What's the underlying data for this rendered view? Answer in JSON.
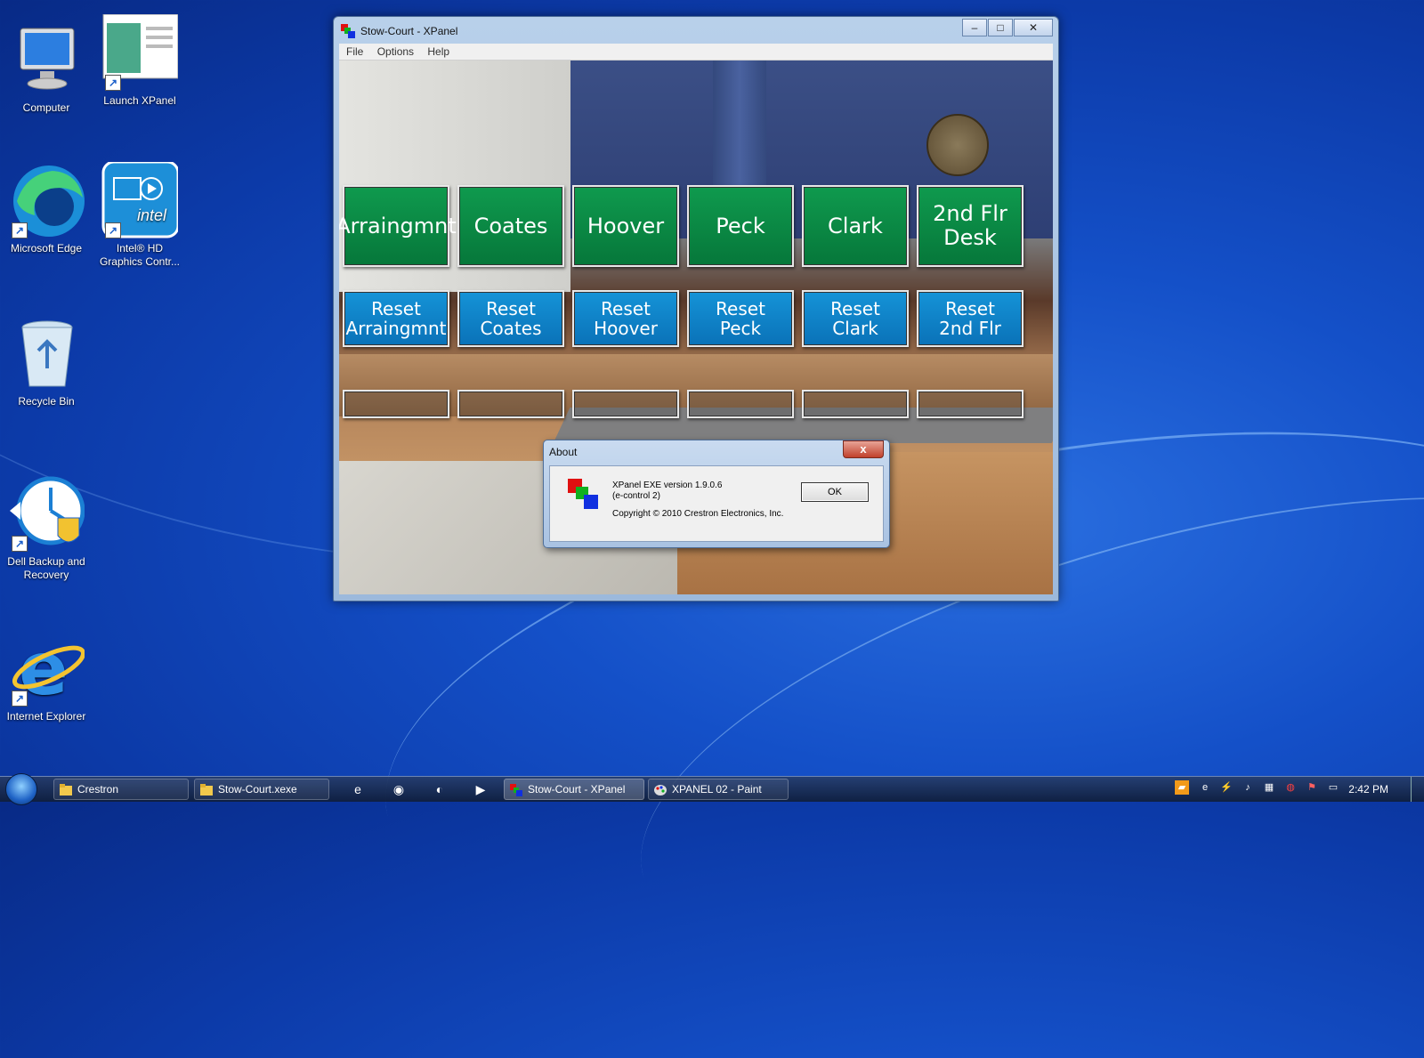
{
  "desktop": {
    "icons": [
      {
        "label": "Computer",
        "icon": "computer-icon"
      },
      {
        "label": "Launch XPanel",
        "icon": "xpanel-launch-icon"
      },
      {
        "label": "Microsoft Edge",
        "icon": "edge-icon"
      },
      {
        "label": "Intel® HD Graphics Contr...",
        "icon": "intel-graphics-icon"
      },
      {
        "label": "Recycle Bin",
        "icon": "recycle-bin-icon"
      },
      {
        "label": "Dell Backup and Recovery",
        "icon": "dell-backup-icon"
      },
      {
        "label": "Internet Explorer",
        "icon": "ie-icon"
      }
    ]
  },
  "window": {
    "title": "Stow-Court - XPanel",
    "controls": {
      "minimize": "–",
      "maximize": "□",
      "close": "✕"
    },
    "menu": [
      "File",
      "Options",
      "Help"
    ]
  },
  "panel": {
    "room_buttons": [
      "Arraingmnt",
      "Coates",
      "Hoover",
      "Peck",
      "Clark",
      "2nd Flr\nDesk"
    ],
    "reset_buttons": [
      "Reset\nArraingmnt",
      "Reset\nCoates",
      "Reset\nHoover",
      "Reset\nPeck",
      "Reset\nClark",
      "Reset\n2nd Flr"
    ],
    "empty_buttons": 6,
    "colors": {
      "room": "#0b8a45",
      "reset": "#0f82c8"
    }
  },
  "about": {
    "title": "About",
    "close": "x",
    "version_line": "XPanel EXE  version 1.9.0.6",
    "subline": "(e-control 2)",
    "copyright": "Copyright © 2010 Crestron Electronics, Inc.",
    "ok": "OK"
  },
  "taskbar": {
    "items": [
      {
        "label": "Crestron",
        "icon": "folder-icon"
      },
      {
        "label": "Stow-Court.xexe",
        "icon": "folder-icon"
      },
      {
        "label": "Stow-Court - XPanel",
        "icon": "xpanel-icon",
        "active": true
      },
      {
        "label": "XPANEL 02 - Paint",
        "icon": "paint-icon"
      }
    ],
    "quick_launch": [
      "ie-icon",
      "chrome-icon",
      "edge-icon",
      "media-player-icon"
    ],
    "tray": [
      "flag-icon",
      "e-icon",
      "network-icon",
      "volume-icon",
      "display-icon",
      "antivirus-icon",
      "action-center-icon",
      "network-monitor-icon"
    ],
    "clock": "2:42 PM"
  }
}
